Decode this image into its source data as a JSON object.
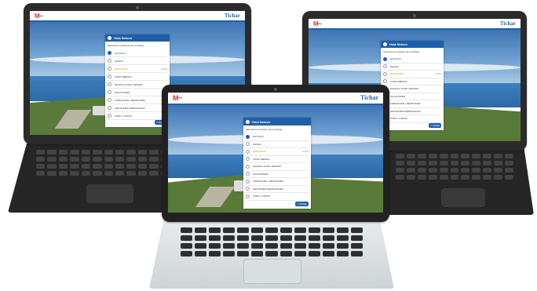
{
  "app": {
    "brand_left": "M",
    "brand_right": "Tichar",
    "panel_title": "Hola Nelson",
    "panel_subtitle": "Selecciona el destino de su fichaje",
    "items": [
      {
        "label": "ENTRADA",
        "state": "selected"
      },
      {
        "label": "SALIDA",
        "state": "normal"
      },
      {
        "label": "DESCANSO",
        "state": "warning",
        "meta": "10:00"
      },
      {
        "label": "VISITA MÉDICA",
        "state": "normal"
      },
      {
        "label": "SALIDA A OTRO CENTRO",
        "state": "normal"
      },
      {
        "label": "VACACIONES",
        "state": "normal"
      },
      {
        "label": "FORMACIÓN / REUNIONES",
        "state": "normal"
      },
      {
        "label": "GESTIONES PERSONALES",
        "state": "normal"
      },
      {
        "label": "OTRO / OTROS",
        "state": "normal"
      }
    ],
    "ok_label": "Fichar"
  },
  "colors": {
    "accent": "#1f5fa8",
    "warning": "#e28a00",
    "brand_red": "#e03232"
  },
  "icons": [
    "user-icon",
    "m-icon",
    "radio-icon",
    "check-icon"
  ]
}
